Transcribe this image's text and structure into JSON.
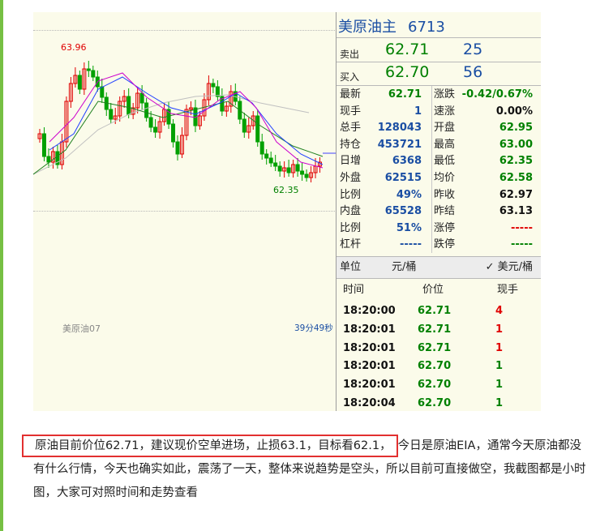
{
  "chart": {
    "high_label": "63.96",
    "low_label": "62.35",
    "contract_label": "美原油07",
    "countdown": "39分49秒",
    "colors": {
      "up": "#e00000",
      "down": "#00a000",
      "ma_white": "#c0c0c0",
      "ma_magenta": "#cc00cc",
      "ma_blue": "#2040ff",
      "ma_green": "#208020"
    }
  },
  "quote": {
    "name": "美原油主",
    "code": "6713",
    "sell_label": "卖出",
    "sell_price": "62.71",
    "sell_volume": "25",
    "buy_label": "买入",
    "buy_price": "62.70",
    "buy_volume": "56",
    "rows": [
      {
        "k": "最新",
        "v": "62.71",
        "vc": "green",
        "k2": "涨跌",
        "v2": "-0.42/0.67%",
        "v2c": "green"
      },
      {
        "k": "现手",
        "v": "1",
        "vc": "blue",
        "k2": "速涨",
        "v2": "0.00%",
        "v2c": "black"
      },
      {
        "k": "总手",
        "v": "128043",
        "vc": "blue",
        "k2": "开盘",
        "v2": "62.95",
        "v2c": "green"
      },
      {
        "k": "持仓",
        "v": "453721",
        "vc": "blue",
        "k2": "最高",
        "v2": "63.00",
        "v2c": "green"
      },
      {
        "k": "日增",
        "v": "6368",
        "vc": "blue",
        "k2": "最低",
        "v2": "62.35",
        "v2c": "green"
      },
      {
        "k": "外盘",
        "v": "62515",
        "vc": "blue",
        "k2": "均价",
        "v2": "62.58",
        "v2c": "green"
      },
      {
        "k": "比例",
        "v": "49%",
        "vc": "blue",
        "k2": "昨收",
        "v2": "62.97",
        "v2c": "black"
      },
      {
        "k": "内盘",
        "v": "65528",
        "vc": "blue",
        "k2": "昨结",
        "v2": "63.13",
        "v2c": "black"
      },
      {
        "k": "比例",
        "v": "51%",
        "vc": "blue",
        "k2": "涨停",
        "v2": "-----",
        "v2c": "red"
      },
      {
        "k": "杠杆",
        "v": "-----",
        "vc": "blue",
        "k2": "跌停",
        "v2": "-----",
        "v2c": "green"
      }
    ],
    "unit_label": "单位",
    "unit_value": "元/桶",
    "unit_option": "✓ 美元/桶",
    "ticks_header": {
      "time": "时间",
      "price": "价位",
      "qty": "现手"
    },
    "ticks": [
      {
        "time": "18:20:00",
        "price": "62.71",
        "qty": "4",
        "qc": "red"
      },
      {
        "time": "18:20:01",
        "price": "62.71",
        "qty": "1",
        "qc": "red"
      },
      {
        "time": "18:20:01",
        "price": "62.71",
        "qty": "1",
        "qc": "red"
      },
      {
        "time": "18:20:01",
        "price": "62.70",
        "qty": "1",
        "qc": "green"
      },
      {
        "time": "18:20:01",
        "price": "62.70",
        "qty": "1",
        "qc": "green"
      },
      {
        "time": "18:20:04",
        "price": "62.70",
        "qty": "1",
        "qc": "green"
      }
    ]
  },
  "article": {
    "highlight": "原油目前价位62.71，建议现价空单进场，止损63.1，目标看62.1，",
    "rest": "今日是原油EIA，通常今天原油都没有什么行情，今天也确实如此，震荡了一天，整体来说趋势是空头，所以目前可直接做空，我截图都是小时图，大家可对照时间和走势查看"
  }
}
